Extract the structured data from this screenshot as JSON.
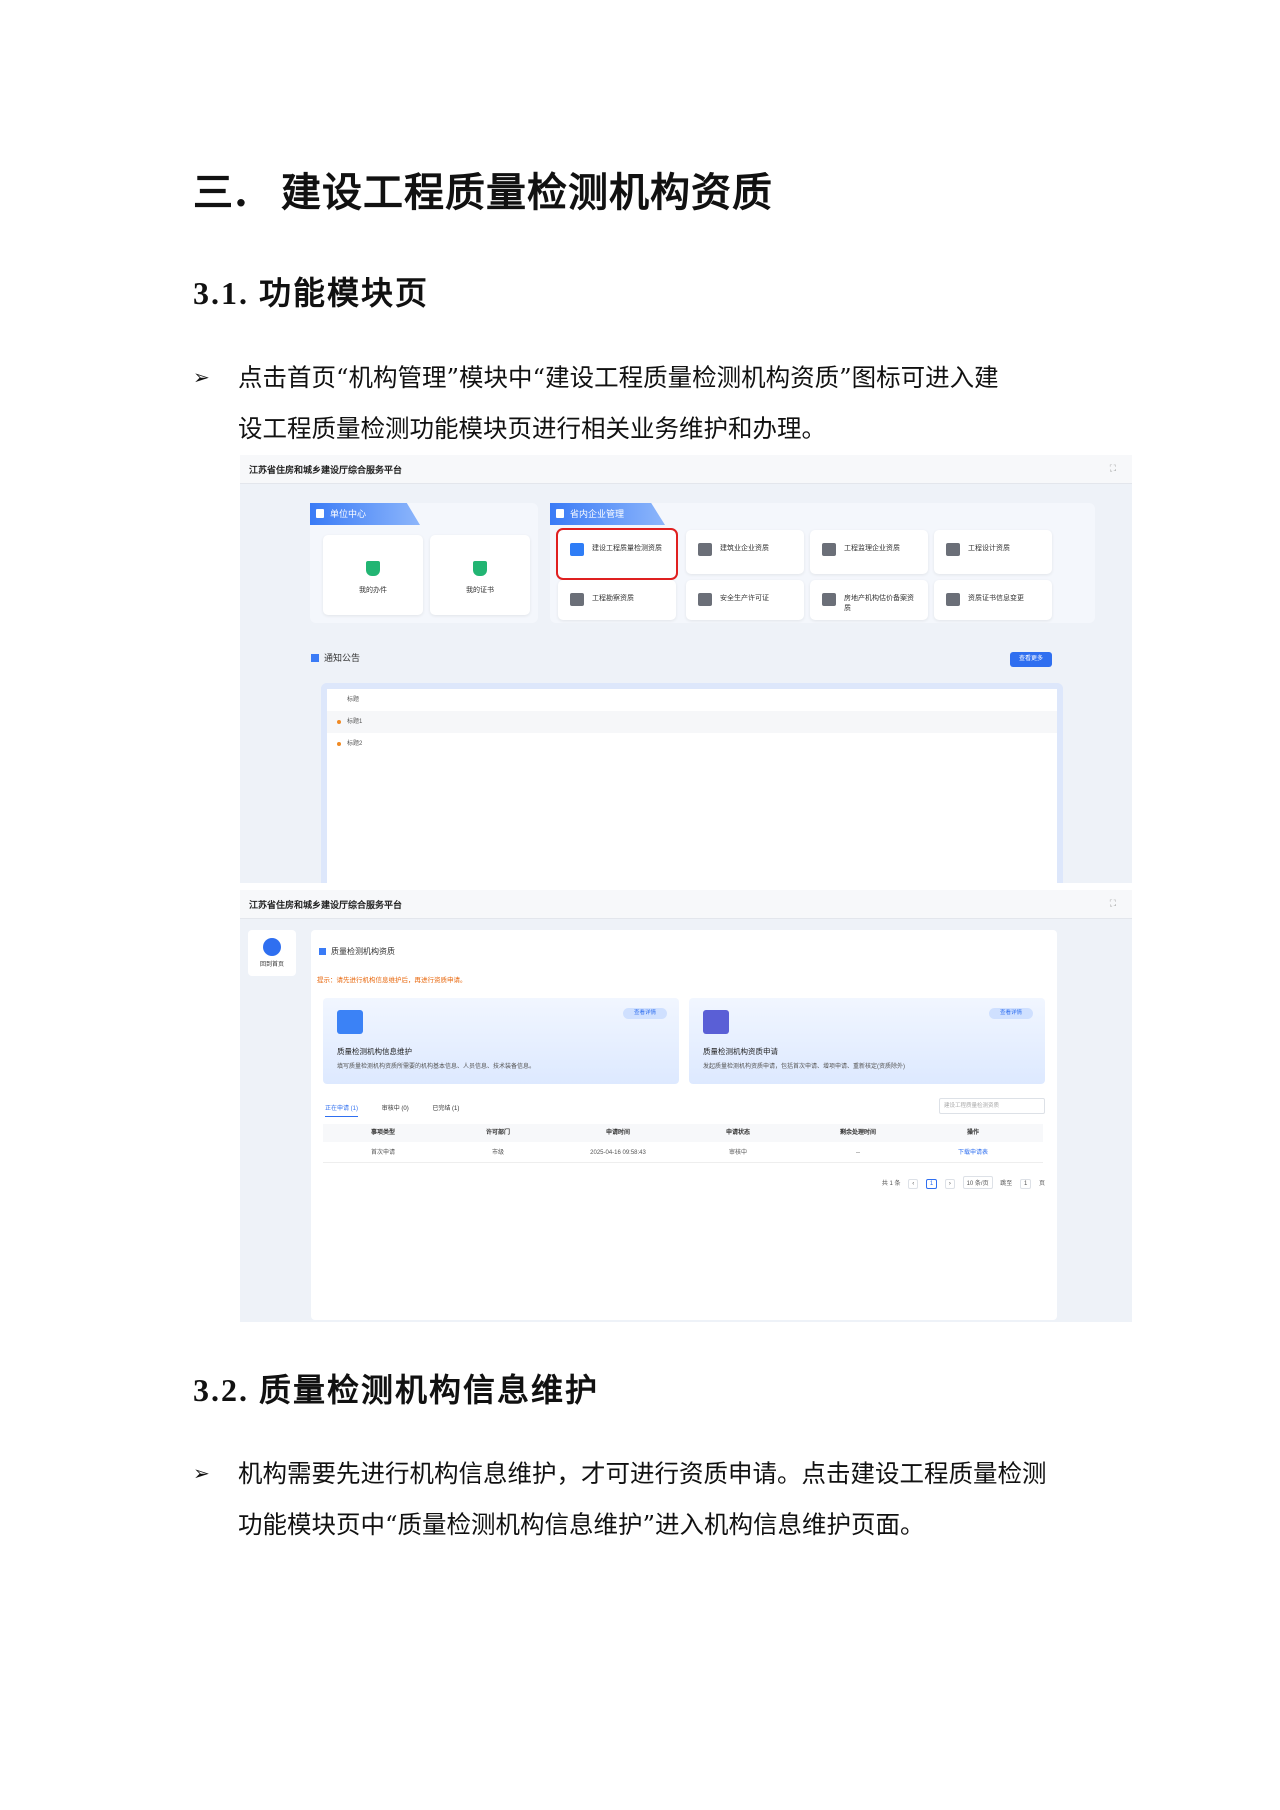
{
  "heading1": {
    "num": "三.",
    "text": "建设工程质量检测机构资质"
  },
  "section1": {
    "num": "3.1.",
    "title": "功能模块页",
    "bullet": "➢",
    "line1": "点击首页“机构管理”模块中“建设工程质量检测机构资质”图标可进入建",
    "line2": "设工程质量检测功能模块页进行相关业务维护和办理。"
  },
  "screenshot1": {
    "platform_title": "江苏省住房和城乡建设厅综合服务平台",
    "fullscreen_icon": "expand-icon",
    "unit_center": {
      "title": "单位中心",
      "tiles": [
        "我的办件",
        "我的证书"
      ]
    },
    "enterprise_mgmt": {
      "title": "省内企业管理",
      "tiles": [
        "建设工程质量检测资质",
        "建筑业企业资质",
        "工程监理企业资质",
        "工程设计资质",
        "工程勘察资质",
        "安全生产许可证",
        "房地产机构估价备案资质",
        "资质证书信息变更"
      ]
    },
    "notice": {
      "title": "通知公告",
      "more_button": "查看更多",
      "header": "标题",
      "items": [
        "标题1",
        "标题2"
      ]
    }
  },
  "screenshot2": {
    "platform_title": "江苏省住房和城乡建设厅综合服务平台",
    "back_home": "回到首页",
    "module_title": "质量检测机构资质",
    "tip": "提示：请先进行机构信息维护后，再进行资质申请。",
    "cards": [
      {
        "button": "查看详情",
        "title": "质量检测机构信息维护",
        "desc": "填写质量检测机构资质所需要的机构基本信息、人员信息、技术装备信息。"
      },
      {
        "button": "查看详情",
        "title": "质量检测机构资质申请",
        "desc": "发起质量检测机构资质申请，包括首次申请、增项申请、重新核定(资质除外)"
      }
    ],
    "tabs": [
      "正在申请 (1)",
      "审核中 (0)",
      "已完结 (1)"
    ],
    "select_placeholder": "建设工程质量检测资质",
    "table": {
      "headers": [
        "事项类型",
        "许可部门",
        "申请时间",
        "申请状态",
        "剩余处理时间",
        "操作"
      ],
      "rows": [
        [
          "首次申请",
          "市级",
          "2025-04-16 09:58:43",
          "审核中",
          "--",
          "下载申请表"
        ]
      ]
    },
    "pager": {
      "total": "共 1 条",
      "page": "1",
      "page_size": "10 条/页",
      "goto": "跳至",
      "goto_value": "1",
      "unit": "页"
    }
  },
  "section2": {
    "num": "3.2.",
    "title": "质量检测机构信息维护",
    "bullet": "➢",
    "line1": "机构需要先进行机构信息维护，才可进行资质申请。点击建设工程质量检测",
    "line2": "功能模块页中“质量检测机构信息维护”进入机构信息维护页面。"
  }
}
